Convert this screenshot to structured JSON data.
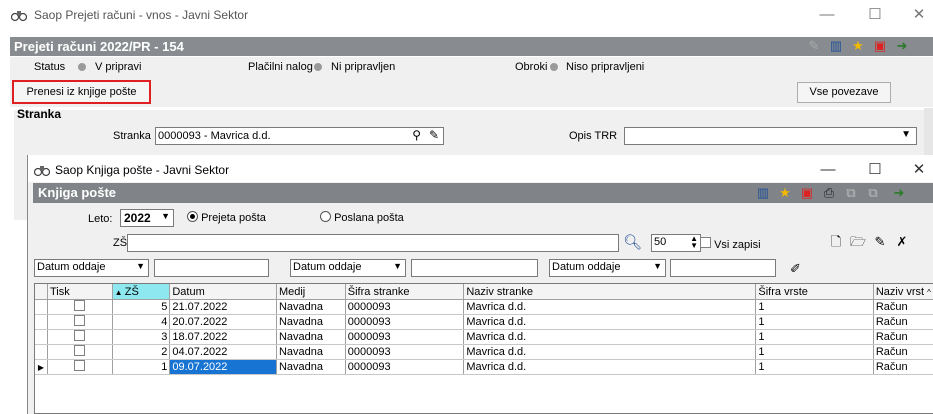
{
  "main_window": {
    "title": "Saop Prejeti računi - vnos - Javni Sektor",
    "band_title": "Prejeti računi 2022/PR - 154",
    "status": {
      "label": "Status",
      "value": "V pripravi"
    },
    "payment": {
      "label": "Plačilni nalog",
      "value": "Ni pripravljen"
    },
    "installments": {
      "label": "Obroki",
      "value": "Niso pripravljeni"
    },
    "transfer_button": "Prenesi iz knjige pošte",
    "all_links_button": "Vse povezave",
    "group_label": "Stranka",
    "client_label": "Stranka",
    "client_value": "0000093 - Mavrica d.d.",
    "trr_label": "Opis TRR"
  },
  "child_window": {
    "title": "Saop Knjiga pošte - Javni Sektor",
    "band_title": "Knjiga pošte",
    "year_label": "Leto:",
    "year_value": "2022",
    "radio_received": "Prejeta pošta",
    "radio_sent": "Poslana pošta",
    "zs_label": "ZŠ",
    "limit_value": "50",
    "all_records_label": "Vsi zapisi",
    "filters": [
      "Datum oddaje",
      "Datum oddaje",
      "Datum oddaje"
    ]
  },
  "grid": {
    "columns": [
      "Tisk",
      "ZŠ",
      "Datum",
      "Medij",
      "Šifra stranke",
      "Naziv stranke",
      "Šifra vrste",
      "Naziv vrst"
    ],
    "rows": [
      {
        "zs": "5",
        "datum": "21.07.2022",
        "medij": "Navadna",
        "sifra": "0000093",
        "naziv": "Mavrica d.d.",
        "vrsta": "1",
        "naziv_vrste": "Račun"
      },
      {
        "zs": "4",
        "datum": "20.07.2022",
        "medij": "Navadna",
        "sifra": "0000093",
        "naziv": "Mavrica d.d.",
        "vrsta": "1",
        "naziv_vrste": "Račun"
      },
      {
        "zs": "3",
        "datum": "18.07.2022",
        "medij": "Navadna",
        "sifra": "0000093",
        "naziv": "Mavrica d.d.",
        "vrsta": "1",
        "naziv_vrste": "Račun"
      },
      {
        "zs": "2",
        "datum": "04.07.2022",
        "medij": "Navadna",
        "sifra": "0000093",
        "naziv": "Mavrica d.d.",
        "vrsta": "1",
        "naziv_vrste": "Račun"
      },
      {
        "zs": "1",
        "datum": "09.07.2022",
        "medij": "Navadna",
        "sifra": "0000093",
        "naziv": "Mavrica d.d.",
        "vrsta": "1",
        "naziv_vrste": "Račun"
      }
    ],
    "selected_row": 4
  },
  "colors": {
    "highlight_border": "#e02020",
    "selected_cell": "#1874d2",
    "sort_header": "#8de8f0"
  }
}
